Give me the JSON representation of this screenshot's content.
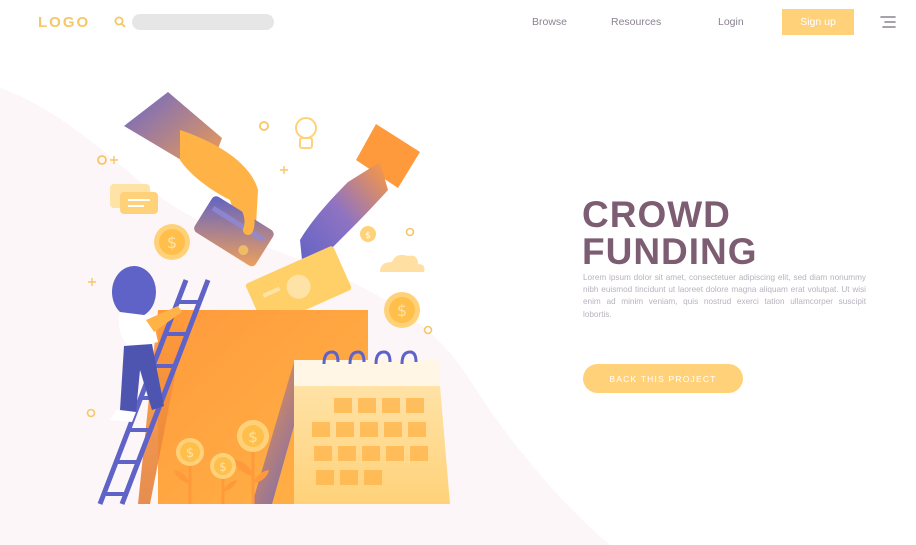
{
  "header": {
    "logo": "LOGO",
    "search_placeholder": "",
    "nav": {
      "browse": "Browse",
      "resources": "Resources",
      "login": "Login"
    },
    "signup_label": "Sign up"
  },
  "hero": {
    "title_line1": "CROWD",
    "title_line2": "FUNDING",
    "body": "Lorem ipsum dolor sit amet, consectetuer adipiscing elit, sed diam nonummy nibh euismod tincidunt ut laoreet dolore magna aliquam erat volutpat. Ut wisi enim ad minim veniam, quis nostrud exerci tation ullamcorper suscipit lobortis.",
    "cta_label": "BACK THIS PROJECT"
  },
  "colors": {
    "accent_yellow": "#ffd27a",
    "logo_yellow": "#f6c667",
    "title_mauve": "#7d5d72",
    "text_gray": "#b9b2bd",
    "nav_gray": "#8a8290",
    "illustration_orange": "#ff9a3c",
    "illustration_purple": "#5f62c6"
  },
  "icons": {
    "search": "search-icon",
    "menu": "hamburger-menu-icon"
  }
}
